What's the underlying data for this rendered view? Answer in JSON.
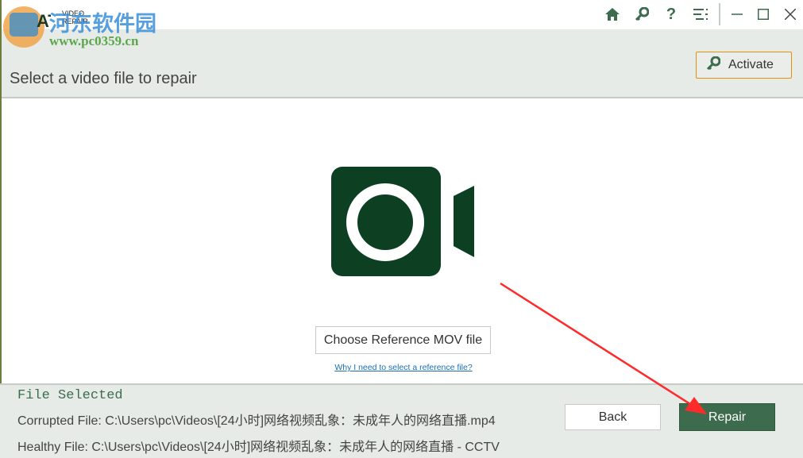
{
  "app": {
    "logo_text": "CAT VIDEO REPAIR",
    "watermark": "河东软件园 www.pc0359.cn"
  },
  "titlebar": {
    "icons": [
      "home-icon",
      "key-icon",
      "help-icon",
      "menu-icon",
      "minimize-icon",
      "maximize-icon",
      "close-icon"
    ]
  },
  "header": {
    "title": "Select a video file to repair",
    "activate_label": "Activate"
  },
  "main": {
    "choose_label": "Choose Reference MOV file",
    "help_link": "Why I need to select a reference file?"
  },
  "bottom": {
    "section_title": "File Selected",
    "corrupted": "Corrupted File: C:\\Users\\pc\\Videos\\[24小时]网络视频乱象：未成年人的网络直播.mp4",
    "healthy": "Healthy File: C:\\Users\\pc\\Videos\\[24小时]网络视频乱象：未成年人的网络直播 - CCTV",
    "back_label": "Back",
    "repair_label": "Repair"
  },
  "colors": {
    "accent": "#3d6b4e",
    "icon_dark": "#0d3f22",
    "activate_border": "#e0920a",
    "link": "#1a6fb5",
    "arrow": "#ff2a2a"
  }
}
